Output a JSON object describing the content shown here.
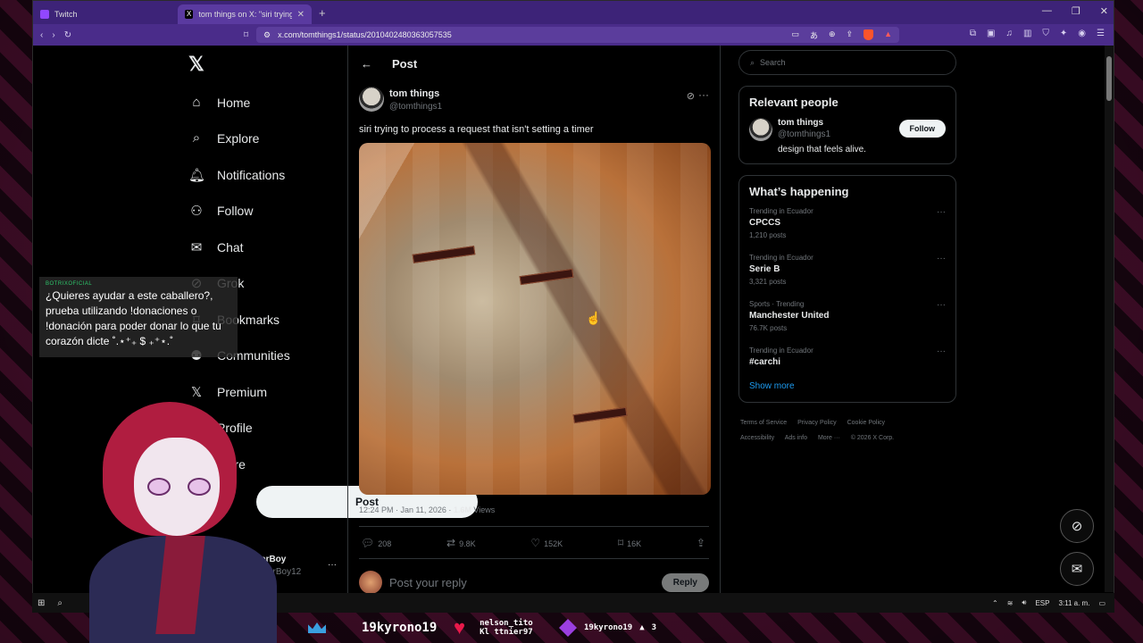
{
  "browser": {
    "tabs": [
      {
        "label": "Twitch",
        "active": false
      },
      {
        "label": "tom things on X: \"siri trying t",
        "active": true
      }
    ],
    "new_tab": "+",
    "url": "x.com/tomthings1/status/2010402480363057535",
    "window_controls": [
      "—",
      "❐",
      "✕"
    ]
  },
  "nav": {
    "logo": "𝕏",
    "items": [
      {
        "label": "Home",
        "icon": "home-icon"
      },
      {
        "label": "Explore",
        "icon": "search-icon"
      },
      {
        "label": "Notifications",
        "icon": "bell-icon"
      },
      {
        "label": "Follow",
        "icon": "person-plus-icon"
      },
      {
        "label": "Chat",
        "icon": "mail-icon"
      },
      {
        "label": "Grok",
        "icon": "grok-icon"
      },
      {
        "label": "Bookmarks",
        "icon": "bookmark-icon"
      },
      {
        "label": "Communities",
        "icon": "people-icon"
      },
      {
        "label": "Premium",
        "icon": "x-icon"
      },
      {
        "label": "Profile",
        "icon": "person-icon"
      },
      {
        "label": "More",
        "icon": "more-icon"
      }
    ],
    "post_button": "Post",
    "account": {
      "name": "TheSpecterBoy",
      "handle": "@TheSpecterBoy12"
    }
  },
  "tweet": {
    "header": "Post",
    "author_name": "tom things",
    "author_handle": "@tomthings1",
    "text": "siri trying to process a request that isn't setting a timer",
    "time": "12:24 PM · Jan 11, 2026 · ",
    "views": "1.6M",
    "views_label": " Views",
    "stats": {
      "replies": "208",
      "reposts": "9.8K",
      "likes": "152K",
      "bookmarks": "16K"
    },
    "reply_placeholder": "Post your reply",
    "reply_button": "Reply"
  },
  "sidebar": {
    "search_placeholder": "Search",
    "relevant_title": "Relevant people",
    "person": {
      "name": "tom things",
      "handle": "@tomthings1",
      "bio": "design that feels alive.",
      "follow": "Follow"
    },
    "happening_title": "What’s happening",
    "trends": [
      {
        "context": "Trending in Ecuador",
        "title": "CPCCS",
        "count": "1,210 posts"
      },
      {
        "context": "Trending in Ecuador",
        "title": "Serie B",
        "count": "3,321 posts"
      },
      {
        "context": "Sports · Trending",
        "title": "Manchester United",
        "count": "76.7K posts"
      },
      {
        "context": "Trending in Ecuador",
        "title": "#carchi",
        "count": ""
      }
    ],
    "show_more": "Show more",
    "footer": [
      "Terms of Service",
      "Privacy Policy",
      "Cookie Policy",
      "Accessibility",
      "Ads info",
      "More ···",
      "© 2026 X Corp."
    ]
  },
  "taskbar": {
    "lang": "ESP",
    "time": "3:11 a. m."
  },
  "chat_overlay": {
    "user": "BOTRIXOFICIAL",
    "message": "¿Quieres ayudar a este caballero?, prueba utilizando !donaciones o !donación para poder donar lo que tu corazón dicte ˚.⋆⁺₊ $ ₊⁺⋆.˚"
  },
  "stream_bar": {
    "top_sub": "19kyrono19",
    "heart_user_1": "nelson_tito",
    "heart_user_2": "Kl ttnier97",
    "gift_user": "19kyrono19",
    "gift_count": "3"
  },
  "colors": {
    "accent": "#1d9bf0",
    "browser_purple": "#4a2c8a",
    "tab_purple": "#3d2378"
  }
}
